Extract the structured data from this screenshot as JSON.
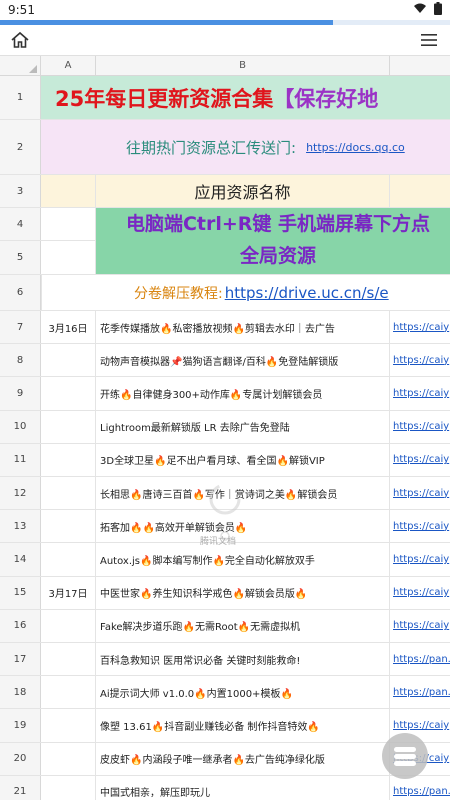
{
  "status": {
    "time": "9:51"
  },
  "progress": {
    "fraction": 0.74
  },
  "header": {
    "col_a": "A",
    "col_b": "B"
  },
  "row_numbers": [
    "1",
    "2",
    "3",
    "4",
    "5",
    "6",
    "7",
    "8",
    "9",
    "10",
    "11",
    "12",
    "13",
    "14",
    "15",
    "16",
    "17",
    "18",
    "19",
    "20",
    "21"
  ],
  "title": {
    "main": "25年每日更新资源合集",
    "paren": "【保存好地"
  },
  "banner": {
    "text": "往期热门资源总汇传送门:",
    "link": "https://docs.qq.co"
  },
  "section_header": {
    "label": "应用资源名称"
  },
  "notice": {
    "line1": "电脑端Ctrl+R键 手机端屏幕下方点",
    "line2": "全局资源"
  },
  "tutorial": {
    "label": "分卷解压教程:",
    "link": "https://drive.uc.cn/s/e"
  },
  "watermark": {
    "text": "腾讯文档"
  },
  "rows": [
    {
      "date": "3月16日",
      "name": "花季传媒播放🔥私密播放视频🔥剪辑去水印｜去广告",
      "link": "https://caiy"
    },
    {
      "date": "",
      "name": "动物声音模拟器📌猫狗语言翻译/百科🔥免登陆解锁版",
      "link": "https://caiy"
    },
    {
      "date": "",
      "name": "开练🔥自律健身300+动作库🔥专属计划解锁会员",
      "link": "https://caiy"
    },
    {
      "date": "",
      "name": "Lightroom最新解锁版 LR 去除广告免登陆",
      "link": "https://caiy"
    },
    {
      "date": "",
      "name": "3D全球卫星🔥足不出户看月球、看全国🔥解锁VIP",
      "link": "https://caiy"
    },
    {
      "date": "",
      "name": "长相思🔥唐诗三百首🔥写作｜赏诗词之美🔥解锁会员",
      "link": "https://caiy"
    },
    {
      "date": "",
      "name": "拓客加🔥🔥高效开单解锁会员🔥",
      "link": "https://caiy"
    },
    {
      "date": "",
      "name": "Autox.js🔥脚本编写制作🔥完全自动化解放双手",
      "link": "https://caiy"
    },
    {
      "date": "3月17日",
      "name": "中医世家🔥养生知识科学戒色🔥解锁会员版🔥",
      "link": "https://caiy"
    },
    {
      "date": "",
      "name": "Fake解决步道乐跑🔥无需Root🔥无需虚拟机",
      "link": "https://caiy"
    },
    {
      "date": "",
      "name": "百科急救知识 医用常识必备 关键时刻能救命!",
      "link": "https://pan."
    },
    {
      "date": "",
      "name": "Ai提示词大师 v1.0.0🔥内置1000+模板🔥",
      "link": "https://pan."
    },
    {
      "date": "",
      "name": "像塑 13.61🔥抖音副业赚钱必备 制作抖音特效🔥",
      "link": "https://caiy"
    },
    {
      "date": "",
      "name": "皮皮虾🔥内涵段子唯一继承者🔥去广告纯净绿化版",
      "link": "https://caiy"
    },
    {
      "date": "",
      "name": "中国式相亲，解压即玩儿",
      "link": "https://pan."
    }
  ]
}
